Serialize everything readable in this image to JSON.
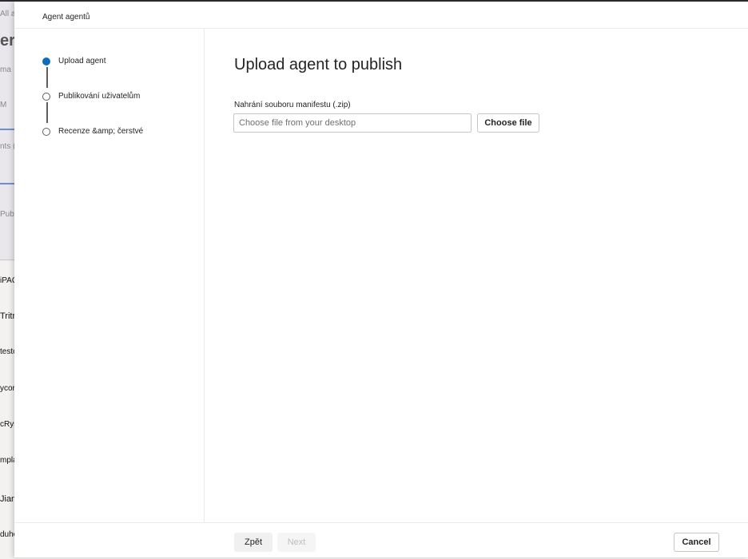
{
  "background": {
    "rows": [
      {
        "text": "All a"
      },
      {
        "text": "er"
      },
      {
        "text": "ma"
      },
      {
        "text": "M"
      },
      {
        "text": "nts ("
      },
      {
        "text": "Pub"
      },
      {
        "text": "iPAQ"
      },
      {
        "text": "Tritrylek"
      },
      {
        "text": "testovací"
      },
      {
        "text": "ycor"
      },
      {
        "text": "cRys"
      },
      {
        "text": "mpla"
      },
      {
        "text": "Jian"
      },
      {
        "text": "duhovka"
      }
    ]
  },
  "panel": {
    "header_title": "Agent agentů",
    "steps": [
      {
        "label": "Upload agent",
        "state": "active"
      },
      {
        "label": "Publikování uživatelům",
        "state": "pending"
      },
      {
        "label": "Recenze &amp; čerstvé",
        "state": "pending"
      }
    ],
    "main": {
      "title": "Upload agent to publish",
      "field_label": "Nahrání souboru manifestu (.zip)",
      "file_placeholder": "Choose file from your desktop",
      "choose_button": "Choose file"
    },
    "footer": {
      "back_label": "Zpět",
      "next_label": "Next",
      "cancel_label": "Cancel"
    }
  },
  "colors": {
    "accent": "#0f6cbd"
  }
}
